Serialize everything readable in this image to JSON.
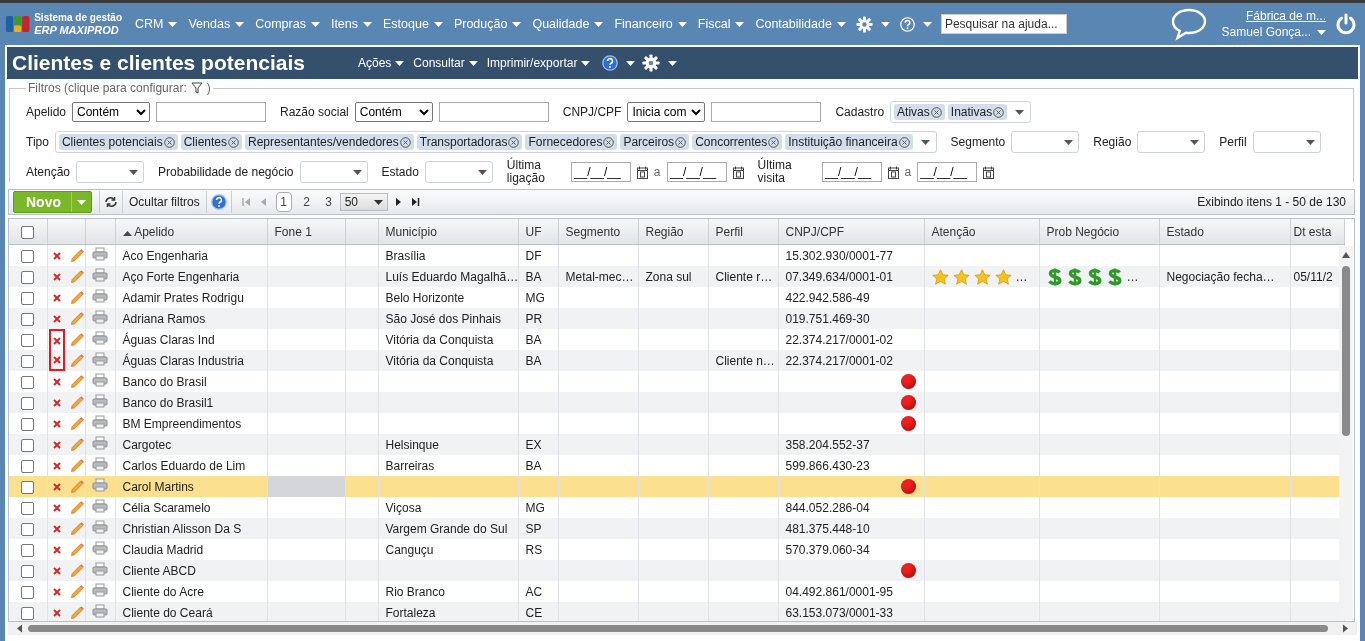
{
  "app": {
    "subtitle": "Sistema de gestão",
    "title": "ERP MAXIPROD"
  },
  "menu": [
    {
      "label": "CRM"
    },
    {
      "label": "Vendas"
    },
    {
      "label": "Compras"
    },
    {
      "label": "Itens"
    },
    {
      "label": "Estoque"
    },
    {
      "label": "Produção"
    },
    {
      "label": "Qualidade"
    },
    {
      "label": "Financeiro"
    },
    {
      "label": "Fiscal"
    },
    {
      "label": "Contabilidade"
    }
  ],
  "help_search": {
    "placeholder": "Pesquisar na ajuda..."
  },
  "user": {
    "company": "Fábrica de m...",
    "name": "Samuel Gonça..."
  },
  "page": {
    "title": "Clientes e clientes potenciais",
    "actions": [
      "Ações",
      "Consultar",
      "Imprimir/exportar"
    ]
  },
  "filters": {
    "legend": "Filtros (clique para configurar:",
    "legend_end": ")",
    "lines": [
      {
        "fields": [
          {
            "kind": "text",
            "label": "Apelido",
            "operator": "Contém"
          },
          {
            "kind": "text",
            "label": "Razão social",
            "operator": "Contém"
          },
          {
            "kind": "text",
            "label": "CNPJ/CPF",
            "operator": "Inicia com"
          },
          {
            "kind": "tags",
            "label": "Cadastro",
            "tags": [
              "Ativas",
              "Inativas"
            ]
          }
        ]
      },
      {
        "fields": [
          {
            "kind": "tags",
            "label": "Tipo",
            "tags": [
              "Clientes potenciais",
              "Clientes",
              "Representantes/vendedores",
              "Transportadoras",
              "Fornecedores",
              "Parceiros",
              "Concorrentes",
              "Instituição financeira"
            ]
          },
          {
            "kind": "dropdown",
            "label": "Segmento"
          },
          {
            "kind": "dropdown",
            "label": "Região"
          },
          {
            "kind": "dropdown",
            "label": "Perfil"
          }
        ]
      },
      {
        "fields": [
          {
            "kind": "dropdown",
            "label": "Atenção"
          },
          {
            "kind": "dropdown",
            "label": "Probabilidade de negócio"
          },
          {
            "kind": "dropdown",
            "label": "Estado"
          },
          {
            "kind": "dates",
            "label": "Última ligação",
            "from": "__/__/__",
            "separator": "a",
            "to": "__/__/__"
          },
          {
            "kind": "dates",
            "label": "Última visita",
            "from": "__/__/__",
            "separator": "a",
            "to": "__/__/__"
          }
        ]
      }
    ]
  },
  "grid": {
    "new_button": "Novo",
    "hide_filters": "Ocultar filtros",
    "pages": [
      {
        "label": "1",
        "selected": true
      },
      {
        "label": "2",
        "selected": false
      },
      {
        "label": "3",
        "selected": false
      }
    ],
    "page_size": "50",
    "select_all": {
      "checked": false
    },
    "summary": "Exibindo itens 1 - 50 de 130",
    "columns": [
      {
        "label": "Apelido",
        "sorted": true
      },
      {
        "label": "Fone 1",
        "sorted": false
      },
      {
        "sorted": false
      },
      {
        "label": "Município",
        "sorted": false
      },
      {
        "label": "UF",
        "sorted": false
      },
      {
        "label": "Segmento",
        "sorted": false
      },
      {
        "label": "Região",
        "sorted": false
      },
      {
        "label": "Perfil",
        "sorted": false
      },
      {
        "label": "CNPJ/CPF",
        "sorted": false
      },
      {
        "label": "Atenção",
        "sorted": false
      },
      {
        "label": "Prob Negócio",
        "sorted": false
      },
      {
        "label": "Estado",
        "sorted": false
      },
      {
        "label": "Dt esta",
        "sorted": false
      }
    ],
    "rows": [
      {
        "selected": false,
        "checked": false,
        "marked": false,
        "flag": false,
        "apelido": "Aco Engenharia",
        "municipio": "Brasília",
        "uf": "DF",
        "cnpj": "15.302.930/0001-77"
      },
      {
        "selected": false,
        "checked": false,
        "marked": false,
        "flag": false,
        "apelido": "Aço Forte Engenharia",
        "municipio": "Luís Eduardo Magalhã…",
        "uf": "BA",
        "segmento": "Metal-mec…",
        "regiao": "Zona sul",
        "perfil": "Cliente r…",
        "cnpj": "07.349.634/0001-01",
        "attention": {
          "stars": 4,
          "more": "…"
        },
        "prob": {
          "stars": 4,
          "more": "…"
        },
        "estado": "Negociação fecha…",
        "dt_estado": "05/11/2"
      },
      {
        "selected": false,
        "checked": false,
        "marked": false,
        "flag": false,
        "apelido": "Adamir Prates Rodrigu",
        "municipio": "Belo Horizonte",
        "uf": "MG",
        "cnpj": "422.942.586-49"
      },
      {
        "selected": false,
        "checked": false,
        "marked": false,
        "flag": false,
        "apelido": "Adriana Ramos",
        "municipio": "São José dos Pinhais",
        "uf": "PR",
        "cnpj": "019.751.469-30"
      },
      {
        "selected": false,
        "checked": false,
        "marked": true,
        "flag": false,
        "apelido": "Águas Claras Ind",
        "municipio": "Vitória da Conquista",
        "uf": "BA",
        "cnpj": "22.374.217/0001-02"
      },
      {
        "selected": false,
        "checked": false,
        "marked": true,
        "flag": false,
        "apelido": "Águas Claras Industria",
        "municipio": "Vitória da Conquista",
        "uf": "BA",
        "perfil": "Cliente n…",
        "cnpj": "22.374.217/0001-02"
      },
      {
        "selected": false,
        "checked": false,
        "marked": false,
        "flag": true,
        "apelido": "Banco do Brasil"
      },
      {
        "selected": false,
        "checked": false,
        "marked": false,
        "flag": true,
        "apelido": "Banco do Brasil1"
      },
      {
        "selected": false,
        "checked": false,
        "marked": false,
        "flag": true,
        "apelido": "BM Empreendimentos"
      },
      {
        "selected": false,
        "checked": false,
        "marked": false,
        "flag": false,
        "apelido": "Cargotec",
        "municipio": "Helsinque",
        "uf": "EX",
        "cnpj": "358.204.552-37"
      },
      {
        "selected": false,
        "checked": false,
        "marked": false,
        "flag": false,
        "apelido": "Carlos Eduardo de Lim",
        "municipio": "Barreiras",
        "uf": "BA",
        "cnpj": "599.866.430-23"
      },
      {
        "selected": true,
        "checked": false,
        "marked": false,
        "flag": true,
        "apelido": "Carol Martins"
      },
      {
        "selected": false,
        "checked": false,
        "marked": false,
        "flag": false,
        "apelido": "Célia Scaramelo",
        "municipio": "Viçosa",
        "uf": "MG",
        "cnpj": "844.052.286-04"
      },
      {
        "selected": false,
        "checked": false,
        "marked": false,
        "flag": false,
        "apelido": "Christian Alisson Da S",
        "municipio": "Vargem Grande do Sul",
        "uf": "SP",
        "cnpj": "481.375.448-10"
      },
      {
        "selected": false,
        "checked": false,
        "marked": false,
        "flag": false,
        "apelido": "Claudia Madrid",
        "municipio": "Canguçu",
        "uf": "RS",
        "cnpj": "570.379.060-34"
      },
      {
        "selected": false,
        "checked": false,
        "marked": false,
        "flag": true,
        "apelido": "Cliente ABCD"
      },
      {
        "selected": false,
        "checked": false,
        "marked": false,
        "flag": false,
        "apelido": "Cliente do Acre",
        "municipio": "Rio Branco",
        "uf": "AC",
        "cnpj": "04.492.861/0001-95"
      },
      {
        "selected": false,
        "checked": false,
        "marked": false,
        "flag": false,
        "apelido": "Cliente do Ceará",
        "municipio": "Fortaleza",
        "uf": "CE",
        "cnpj": "63.153.073/0001-33"
      }
    ]
  }
}
